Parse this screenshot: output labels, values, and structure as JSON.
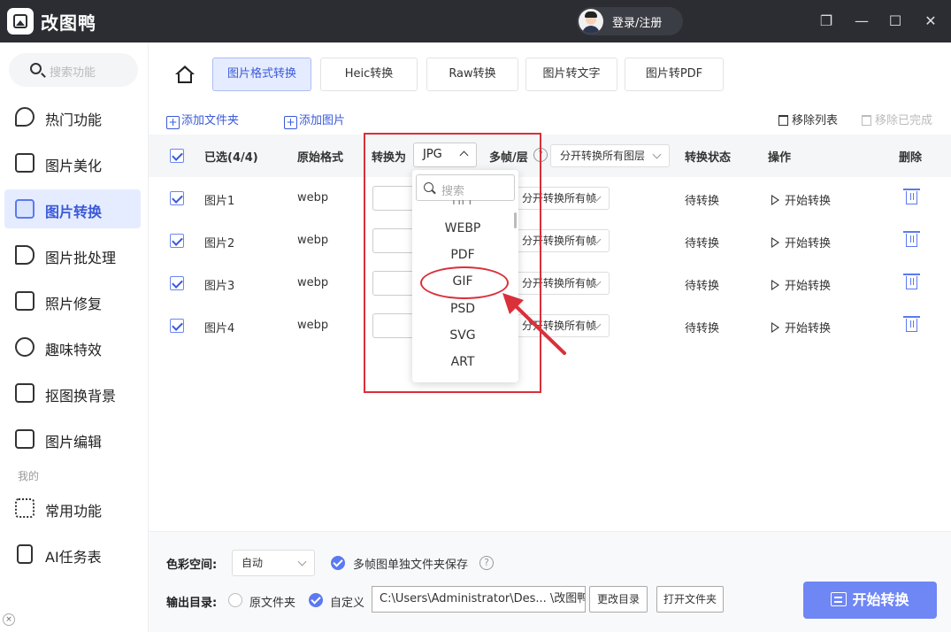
{
  "app": {
    "title": "改图鸭",
    "login_label": "登录/注册"
  },
  "window_controls": {
    "restore": "❐",
    "minimize": "—",
    "maximize": "☐",
    "close": "✕"
  },
  "sidebar": {
    "search_placeholder": "搜索功能",
    "items": [
      {
        "label": "热门功能",
        "icon": "flame-icon"
      },
      {
        "label": "图片美化",
        "icon": "image-beautify-icon"
      },
      {
        "label": "图片转换",
        "icon": "convert-icon",
        "active": true
      },
      {
        "label": "图片批处理",
        "icon": "batch-icon"
      },
      {
        "label": "照片修复",
        "icon": "repair-icon"
      },
      {
        "label": "趣味特效",
        "icon": "sparkle-icon"
      },
      {
        "label": "抠图换背景",
        "icon": "cutout-icon"
      },
      {
        "label": "图片编辑",
        "icon": "edit-icon"
      }
    ],
    "section_mine": "我的",
    "mine_items": [
      {
        "label": "常用功能",
        "icon": "grid-icon"
      },
      {
        "label": "AI任务表",
        "icon": "task-list-icon"
      }
    ]
  },
  "tabs": [
    {
      "label": "图片格式转换",
      "active": true
    },
    {
      "label": "Heic转换"
    },
    {
      "label": "Raw转换"
    },
    {
      "label": "图片转文字"
    },
    {
      "label": "图片转PDF"
    }
  ],
  "toolbar": {
    "add_folder": "添加文件夹",
    "add_image": "添加图片",
    "remove_list": "移除列表",
    "remove_done": "移除已完成"
  },
  "table": {
    "headers": {
      "selected": "已选(4/4)",
      "orig_format": "原始格式",
      "convert_to": "转换为",
      "frames": "多帧/层",
      "status": "转换状态",
      "action": "操作",
      "delete": "删除"
    },
    "convert_to_value": "JPG",
    "layer_mode": "分开转换所有图层",
    "rows": [
      {
        "name": "图片1",
        "format": "webp",
        "frame_mode": "分开转换所有帧",
        "status": "待转换",
        "action": "开始转换"
      },
      {
        "name": "图片2",
        "format": "webp",
        "frame_mode": "分开转换所有帧",
        "status": "待转换",
        "action": "开始转换"
      },
      {
        "name": "图片3",
        "format": "webp",
        "frame_mode": "分开转换所有帧",
        "status": "待转换",
        "action": "开始转换"
      },
      {
        "name": "图片4",
        "format": "webp",
        "frame_mode": "分开转换所有帧",
        "status": "待转换",
        "action": "开始转换"
      }
    ]
  },
  "dropdown": {
    "search_placeholder": "搜索",
    "cut_option": "TIFF",
    "options": [
      "WEBP",
      "PDF",
      "GIF",
      "PSD",
      "SVG",
      "ART"
    ],
    "highlighted": "GIF"
  },
  "bottom": {
    "color_space_label": "色彩空间:",
    "color_space_value": "自动",
    "multi_frame_label": "多帧图单独文件夹保存",
    "output_label": "输出目录:",
    "opt_original": "原文件夹",
    "opt_custom": "自定义",
    "path": "C:\\Users\\Administrator\\Des... \\改图鸭",
    "change_dir": "更改目录",
    "open_folder": "打开文件夹",
    "start": "开始转换"
  },
  "colors": {
    "accent": "#5b79f0",
    "annotation": "#d9303a"
  }
}
